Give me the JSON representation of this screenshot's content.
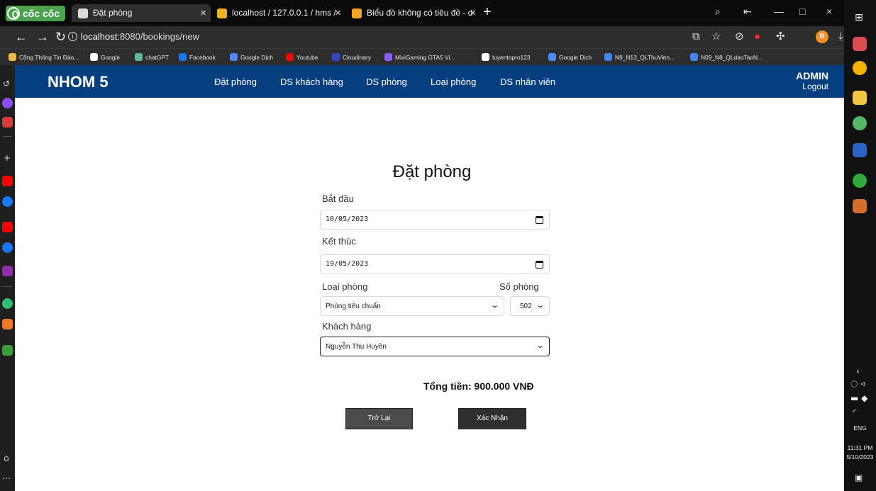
{
  "browser": {
    "brand": "cốc cốc",
    "tabs": [
      {
        "title": "Đặt phòng",
        "favicon_color": "#dcdcdc",
        "active": true
      },
      {
        "title": "localhost / 127.0.0.1 / hms /",
        "favicon_color": "#f2b21b",
        "active": false
      },
      {
        "title": "Biểu đồ không có tiêu đề - d",
        "favicon_color": "#f5a623",
        "active": false
      }
    ],
    "new_tab": "+",
    "url_host": "localhost",
    "url_path": ":8080/bookings/new",
    "profile_initial": "B",
    "bookmarks": [
      {
        "label": "Cổng Thông Tin Đào...",
        "color": "#e6b94a"
      },
      {
        "label": "Google",
        "color": "#ffffff"
      },
      {
        "label": "chatGPT",
        "color": "#5fb89a"
      },
      {
        "label": "Facebook",
        "color": "#1877f2"
      },
      {
        "label": "Google Dịch",
        "color": "#4c8bf5"
      },
      {
        "label": "Youtube",
        "color": "#ff0000"
      },
      {
        "label": "Cloudinary",
        "color": "#3448c5"
      },
      {
        "label": "MixiGaming GTA5 Vi...",
        "color": "#8a5cff"
      },
      {
        "label": "tuyentopro123",
        "color": "#ffffff"
      },
      {
        "label": "Google Dịch",
        "color": "#4c8bf5"
      },
      {
        "label": "N9_N13_QLThuVien...",
        "color": "#4285f4"
      },
      {
        "label": "N09_N8_QLdaoTaoN...",
        "color": "#4285f4"
      }
    ]
  },
  "app": {
    "logo": "NHOM 5",
    "menu": [
      "Đặt phòng",
      "DS khách hàng",
      "DS phòng",
      "Loại phòng",
      "DS nhân viên"
    ],
    "user": "ADMIN",
    "logout": "Logout"
  },
  "form": {
    "title": "Đặt phòng",
    "start_label": "Bắt đầu",
    "start_value": "10/05/2023",
    "end_label": "Kết thúc",
    "end_value": "19/05/2023",
    "room_type_label": "Loại phòng",
    "room_type_value": "Phòng tiêu chuẩn",
    "room_number_label": "Số phòng",
    "room_number_value": "502",
    "customer_label": "Khách hàng",
    "customer_value": "Nguyễn Thu Huyền",
    "total": "Tổng tiền: 900.000 VNĐ",
    "back_button": "Trở Lại",
    "confirm_button": "Xác Nhận"
  },
  "taskbar": {
    "language": "ENG",
    "time": "11:31 PM",
    "date": "5/10/2023"
  },
  "colors": {
    "navbar": "#063f80",
    "button_back": "#4b4b4b",
    "button_confirm": "#2f2f2f",
    "browser_dark": "#0b0b0b"
  }
}
